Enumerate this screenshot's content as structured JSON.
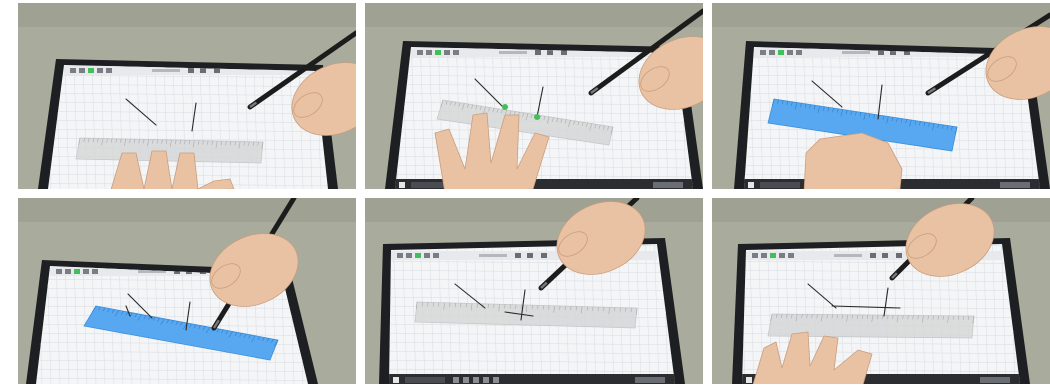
{
  "figure": {
    "panel_count": 6,
    "rows": 2,
    "columns": 3
  },
  "colors": {
    "desk": "#a9ab9c",
    "tablet_bezel": "#1e1f22",
    "screen": "#f4f5f7",
    "grid_line": "#dcdfe4",
    "ruler_gray": "#d6d7d8",
    "ruler_blue": "#57a8f0",
    "skin": "#e9c2a3",
    "pen": "#1c1c1c",
    "stroke": "#2a2a2a",
    "toolbar_green": "#41c05a"
  },
  "panels": [
    {
      "name": "panel-1",
      "ruler_state": "gray",
      "hand": "left-flat",
      "windows_taskbar": false
    },
    {
      "name": "panel-2",
      "ruler_state": "gray-angled",
      "hand": "left-touch",
      "windows_taskbar": true
    },
    {
      "name": "panel-3",
      "ruler_state": "blue",
      "hand": "left-fist",
      "windows_taskbar": true
    },
    {
      "name": "panel-4",
      "ruler_state": "blue",
      "hand": "none",
      "windows_taskbar": false
    },
    {
      "name": "panel-5",
      "ruler_state": "gray",
      "hand": "none",
      "windows_taskbar": true
    },
    {
      "name": "panel-6",
      "ruler_state": "gray",
      "hand": "left-flat",
      "windows_taskbar": true
    }
  ]
}
